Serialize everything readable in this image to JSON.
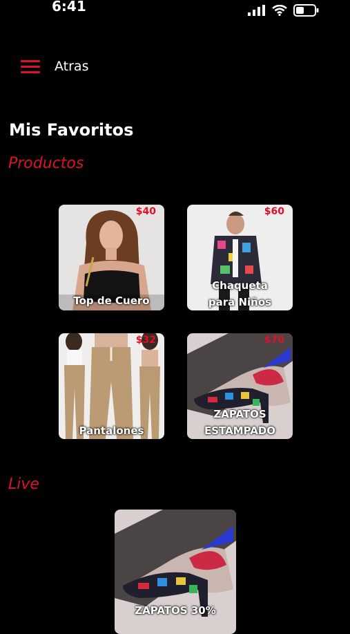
{
  "status_bar": {
    "time": "6:41"
  },
  "header": {
    "menu_icon": "hamburger-menu-icon",
    "back_label": "Atras"
  },
  "page_title": "Mis Favoritos",
  "products_section": {
    "title": "Productos",
    "items": [
      {
        "name": "Top de Cuero",
        "price": "$40"
      },
      {
        "name": "Chaqueta para Niños",
        "price": "$60"
      },
      {
        "name": "Pantalones",
        "price": "$32"
      },
      {
        "name": "ZAPATOS ESTAMPADO",
        "price": "$70"
      }
    ]
  },
  "live_section": {
    "title": "Live",
    "items": [
      {
        "name": "ZAPATOS 30%"
      }
    ]
  },
  "colors": {
    "accent": "#e0102a",
    "background": "#000000",
    "text": "#ffffff"
  }
}
